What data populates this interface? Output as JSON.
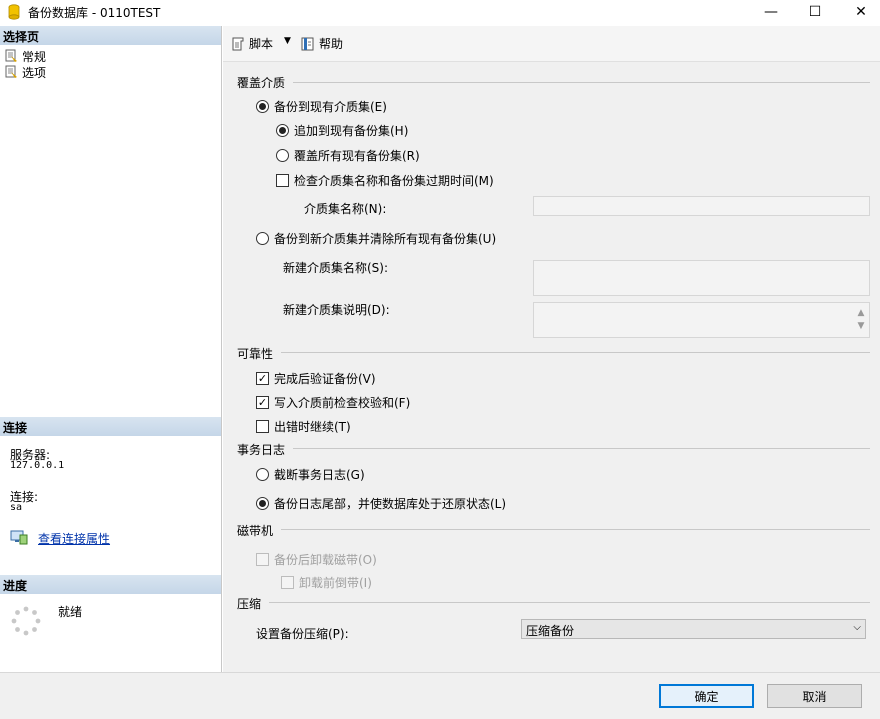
{
  "window": {
    "title": "备份数据库 - 0110TEST",
    "controls": {
      "minimize": "—",
      "maximize": "☐",
      "close": "✕"
    }
  },
  "left": {
    "select_page_header": "选择页",
    "pages": [
      {
        "label": "常规",
        "icon": "page-icon"
      },
      {
        "label": "选项",
        "icon": "page-icon"
      }
    ],
    "connection_header": "连接",
    "server_label": "服务器:",
    "server_value": "127.0.0.1",
    "connection_label": "连接:",
    "connection_value": "sa",
    "view_conn_props": "查看连接属性",
    "progress_header": "进度",
    "progress_status": "就绪"
  },
  "toolbar": {
    "script_label": "脚本",
    "help_label": "帮助"
  },
  "overwrite_media": {
    "title": "覆盖介质",
    "backup_existing": "备份到现有介质集(E)",
    "append": "追加到现有备份集(H)",
    "overwrite_all": "覆盖所有现有备份集(R)",
    "check_name_expiry": "检查介质集名称和备份集过期时间(M)",
    "media_set_name_label": "介质集名称(N):",
    "backup_new": "备份到新介质集并清除所有现有备份集(U)",
    "new_media_name_label": "新建介质集名称(S):",
    "new_media_desc_label": "新建介质集说明(D):"
  },
  "reliability": {
    "title": "可靠性",
    "verify": "完成后验证备份(V)",
    "checksum": "写入介质前检查校验和(F)",
    "continue_on_error": "出错时继续(T)"
  },
  "transaction_log": {
    "title": "事务日志",
    "truncate": "截断事务日志(G)",
    "tail_log": "备份日志尾部，并使数据库处于还原状态(L)"
  },
  "tape": {
    "title": "磁带机",
    "unload": "备份后卸载磁带(O)",
    "rewind": "卸载前倒带(I)"
  },
  "compression": {
    "title": "压缩",
    "label": "设置备份压缩(P):",
    "selected": "压缩备份"
  },
  "buttons": {
    "ok": "确定",
    "cancel": "取消"
  }
}
